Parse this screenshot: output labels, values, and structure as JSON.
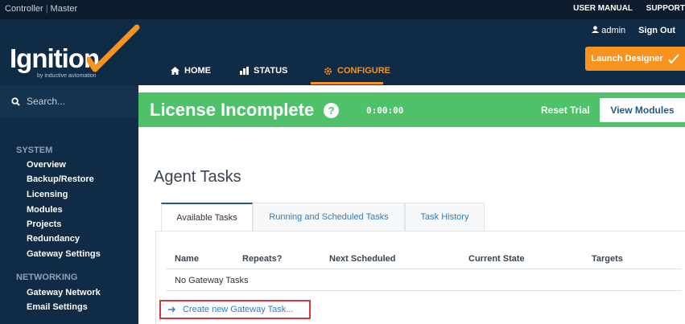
{
  "topbar": {
    "context_left": "Controller",
    "context_right": "Master",
    "links": [
      "USER MANUAL",
      "SUPPORT"
    ]
  },
  "header": {
    "logo_text": "Ignition",
    "logo_tagline": "by inductive automation",
    "nav": [
      {
        "label": "HOME",
        "icon": "home-icon"
      },
      {
        "label": "STATUS",
        "icon": "bar-chart-icon"
      },
      {
        "label": "CONFIGURE",
        "icon": "gear-icon",
        "active": true
      }
    ],
    "user": "admin",
    "sign_out": "Sign Out",
    "launch_designer": "Launch Designer"
  },
  "sidebar": {
    "search_placeholder": "Search...",
    "sections": [
      {
        "title": "SYSTEM",
        "items": [
          "Overview",
          "Backup/Restore",
          "Licensing",
          "Modules",
          "Projects",
          "Redundancy",
          "Gateway Settings"
        ]
      },
      {
        "title": "NETWORKING",
        "items": [
          "Gateway Network",
          "Email Settings"
        ]
      }
    ]
  },
  "banner": {
    "title": "License Incomplete",
    "help_glyph": "?",
    "timer": "0:00:00",
    "reset_trial": "Reset Trial",
    "view_modules": "View Modules"
  },
  "main": {
    "page_title": "Agent Tasks",
    "tabs": [
      {
        "label": "Available Tasks",
        "active": true
      },
      {
        "label": "Running and Scheduled Tasks"
      },
      {
        "label": "Task History"
      }
    ],
    "table": {
      "headers": [
        "Name",
        "Repeats?",
        "Next Scheduled",
        "Current State",
        "Targets"
      ],
      "empty_text": "No Gateway Tasks"
    },
    "create_link": "Create new Gateway Task..."
  },
  "colors": {
    "header_bg": "#0f2b45",
    "accent_orange": "#f7931e",
    "banner_green": "#4ec16a",
    "link_blue": "#2e7bc0",
    "highlight_red": "#d9383a"
  }
}
